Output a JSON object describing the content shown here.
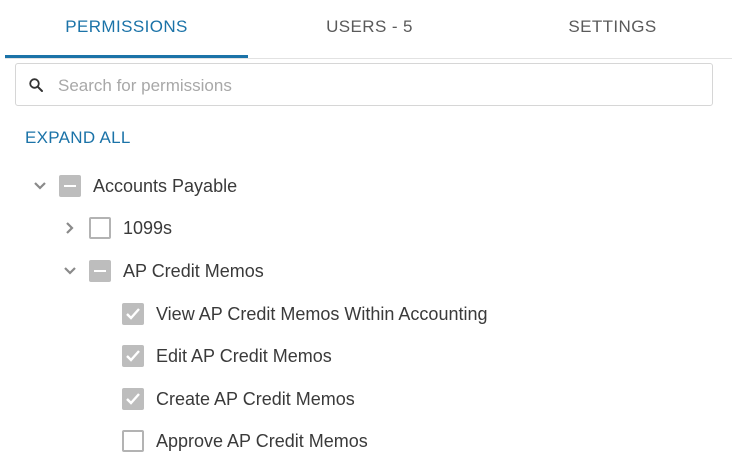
{
  "tabs": [
    {
      "label": "PERMISSIONS",
      "active": true
    },
    {
      "label": "USERS - 5",
      "active": false
    },
    {
      "label": "SETTINGS",
      "active": false
    }
  ],
  "search": {
    "placeholder": "Search for permissions",
    "value": "",
    "icon": "search-icon"
  },
  "expand_all_label": "EXPAND ALL",
  "colors": {
    "accent": "#1b73a8",
    "checkbox_fill": "#bdbdbd",
    "text": "#3a3a3a"
  },
  "tree": {
    "accounts_payable": {
      "label": "Accounts Payable",
      "expanded": true,
      "state": "indeterminate"
    },
    "form_1099s": {
      "label": "1099s",
      "expanded": false,
      "state": "unchecked"
    },
    "ap_credit_memos": {
      "label": "AP Credit Memos",
      "expanded": true,
      "state": "indeterminate"
    },
    "permissions": [
      {
        "label": "View AP Credit Memos Within Accounting",
        "state": "checked"
      },
      {
        "label": "Edit AP Credit Memos",
        "state": "checked"
      },
      {
        "label": "Create AP Credit Memos",
        "state": "checked"
      },
      {
        "label": "Approve AP Credit Memos",
        "state": "unchecked"
      }
    ]
  }
}
